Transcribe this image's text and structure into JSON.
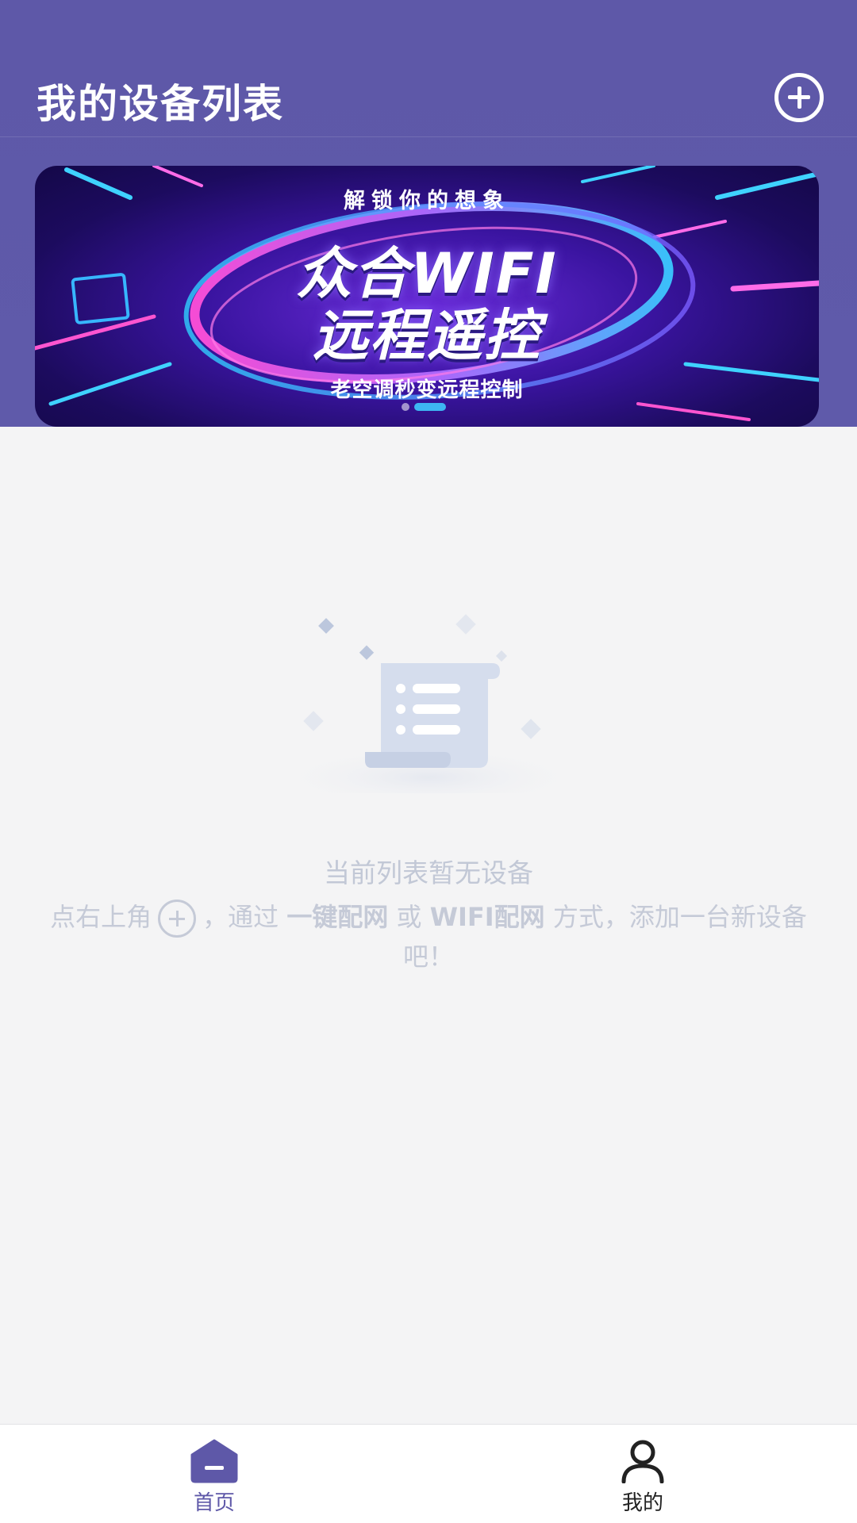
{
  "header": {
    "title": "我的设备列表",
    "add_icon": "plus-circle-icon"
  },
  "banner": {
    "subtitle": "解锁你的想象",
    "line1": "众合WIFI",
    "line2": "远程遥控",
    "caption": "老空调秒变远程控制",
    "slides_total": 2,
    "active_slide": 2
  },
  "empty_state": {
    "illustration": "document-list-icon",
    "title": "当前列表暂无设备",
    "desc_part1": "点右上角",
    "desc_part2": "，通过",
    "desc_bold1": "一键配网",
    "desc_part3": "或",
    "desc_bold2": "WIFI配网",
    "desc_part4": "方式，添加一台新设备吧！"
  },
  "tabbar": {
    "home_label": "首页",
    "home_icon": "home-icon",
    "mine_label": "我的",
    "mine_icon": "user-icon"
  },
  "colors": {
    "header_bg": "#5e58a8",
    "accent": "#5e58a8",
    "page_bg": "#f4f4f5",
    "empty_text": "#c5cad7",
    "indicator_active": "#3db6f2"
  }
}
